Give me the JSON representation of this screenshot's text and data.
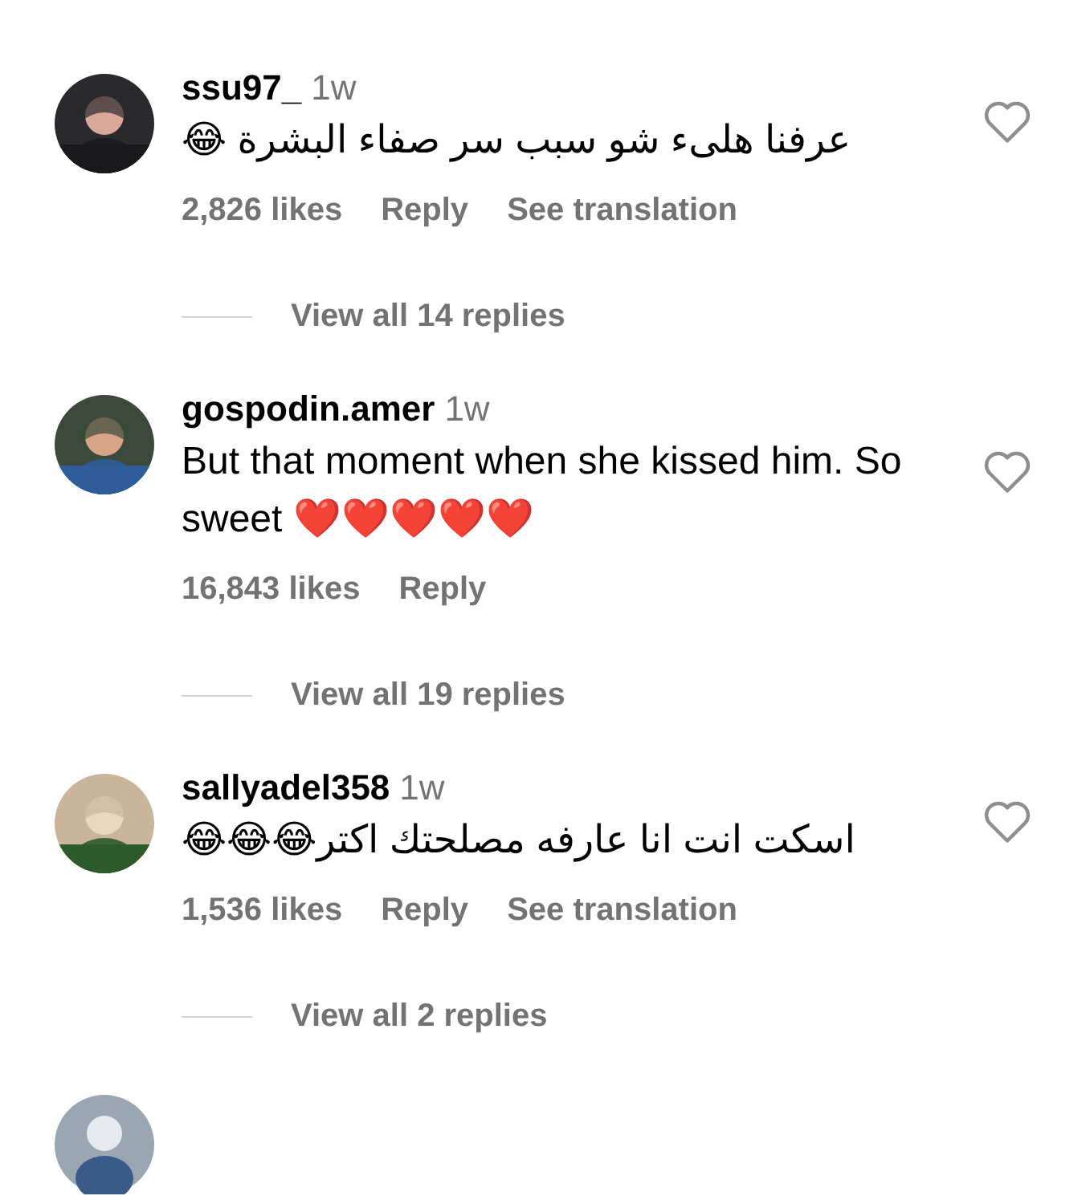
{
  "comments": [
    {
      "username": "ssu97_",
      "time": "1w",
      "text": "عرفنا هلىء شو سبب سر صفاء البشرة 😂",
      "liked": false,
      "likes": "2,826 likes",
      "actions": [
        "Reply",
        "See translation"
      ],
      "view_replies": "View all 14 replies"
    },
    {
      "username": "gospodin.amer",
      "time": "1w",
      "text": "But that moment when she kissed him. So sweet ❤️❤️❤️❤️❤️",
      "liked": false,
      "likes": "16,843 likes",
      "actions": [
        "Reply"
      ],
      "view_replies": "View all 19 replies"
    },
    {
      "username": "sallyadel358",
      "time": "1w",
      "text": "اسكت انت انا عارفه مصلحتك اكتر😂😂😂",
      "liked": false,
      "likes": "1,536 likes",
      "actions": [
        "Reply",
        "See translation"
      ],
      "view_replies": "View all 2 replies"
    }
  ]
}
